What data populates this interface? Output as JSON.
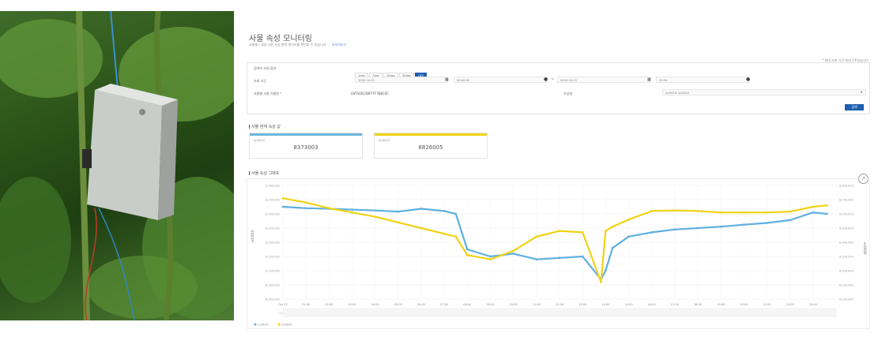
{
  "page": {
    "title": "사물 속성 모니터링",
    "description": "사물별 / 세부 사용 속성 항목 데이터를 확인할 수 있습니다.",
    "description_link": "자세히보기",
    "top_right_note": "* 최대 조회 기간 최대 1주일입니다"
  },
  "form": {
    "label_type": "검색어 조회 옵션",
    "time_buttons": [
      "1day",
      "7day",
      "15day",
      "30day",
      "OFF"
    ],
    "time_selected": "OFF",
    "label_period": "조회 기간",
    "start_date": "2020-10-22",
    "start_time": "00:00:00",
    "separator": "~",
    "end_date": "2020-10-22",
    "end_time": "23:59",
    "label_thing": "사물별 사물 이름명 *",
    "thing_value": "LNTS0023BFFFF788C0C",
    "label_attr": "속성명",
    "attr_value": "sci0010: sci0010",
    "search_button": "검색"
  },
  "current": {
    "section_title": "사물 현재 속성 값",
    "cards": [
      {
        "label": "sci0010",
        "value": "8373003",
        "color": "#6fb7dd"
      },
      {
        "label": "sci0020",
        "value": "8826005",
        "color": "#f0d314"
      }
    ]
  },
  "graph": {
    "section_title": "사물 속성 그래프",
    "expand_icon": "↗"
  },
  "chart_data": {
    "type": "scatter",
    "yticks": [
      "8,400,000",
      "8,350,000",
      "8,300,000",
      "8,250,000",
      "8,200,000",
      "8,150,000",
      "8,100,000",
      "8,050,000",
      "8,000,000"
    ],
    "yticks_right": [
      "8,600,000",
      "8,550,000",
      "8,500,000",
      "8,450,000",
      "8,400,000",
      "8,350,000",
      "8,300,000",
      "8,250,000",
      "8,200,000"
    ],
    "ylabel_left": "sci0010",
    "ylabel_right": "sci0020",
    "xticks": [
      "Oct 22",
      "01:00",
      "02:00",
      "03:00",
      "04:00",
      "05:00",
      "06:00",
      "07:00",
      "08:00",
      "09:00",
      "10:00",
      "11:00",
      "12:00",
      "13:00",
      "14:00",
      "15:00",
      "16:00",
      "17:00",
      "18:00",
      "19:00",
      "20:00",
      "21:00",
      "22:00",
      "23:00"
    ],
    "x_hours": [
      0,
      1,
      2,
      3,
      4,
      5,
      6,
      7,
      7.5,
      8,
      9,
      10,
      11,
      12,
      13,
      13.8,
      14,
      14.3,
      15,
      16,
      17,
      18,
      19,
      20,
      21,
      22,
      23,
      23.6
    ],
    "series": [
      {
        "name": "sci0010",
        "color": "#5fb0e0",
        "x": [
          0,
          1,
          2,
          3,
          4,
          5,
          6,
          7,
          7.5,
          8,
          9,
          10,
          11,
          12,
          13,
          13.8,
          14,
          14.3,
          15,
          16,
          17,
          18,
          19,
          20,
          21,
          22,
          23,
          23.6
        ],
        "y": [
          8325000,
          8320000,
          8318000,
          8315000,
          8312000,
          8308000,
          8318000,
          8310000,
          8300000,
          8175000,
          8150000,
          8160000,
          8140000,
          8145000,
          8150000,
          8070000,
          8100000,
          8180000,
          8220000,
          8235000,
          8245000,
          8250000,
          8255000,
          8262000,
          8268000,
          8278000,
          8305000,
          8300000
        ]
      },
      {
        "name": "sci0020",
        "color": "#f0d314",
        "x": [
          0,
          1,
          2,
          3,
          4,
          5,
          6,
          7,
          7.5,
          8,
          9,
          10,
          11,
          12,
          13,
          13.8,
          14,
          14.3,
          15,
          16,
          17,
          18,
          19,
          20,
          21,
          22,
          23,
          23.6
        ],
        "y": [
          8555000,
          8540000,
          8520000,
          8505000,
          8490000,
          8470000,
          8450000,
          8430000,
          8420000,
          8355000,
          8340000,
          8370000,
          8420000,
          8440000,
          8435000,
          8260000,
          8440000,
          8455000,
          8480000,
          8510000,
          8512000,
          8510000,
          8505000,
          8505000,
          8505000,
          8508000,
          8525000,
          8530000
        ]
      }
    ]
  }
}
